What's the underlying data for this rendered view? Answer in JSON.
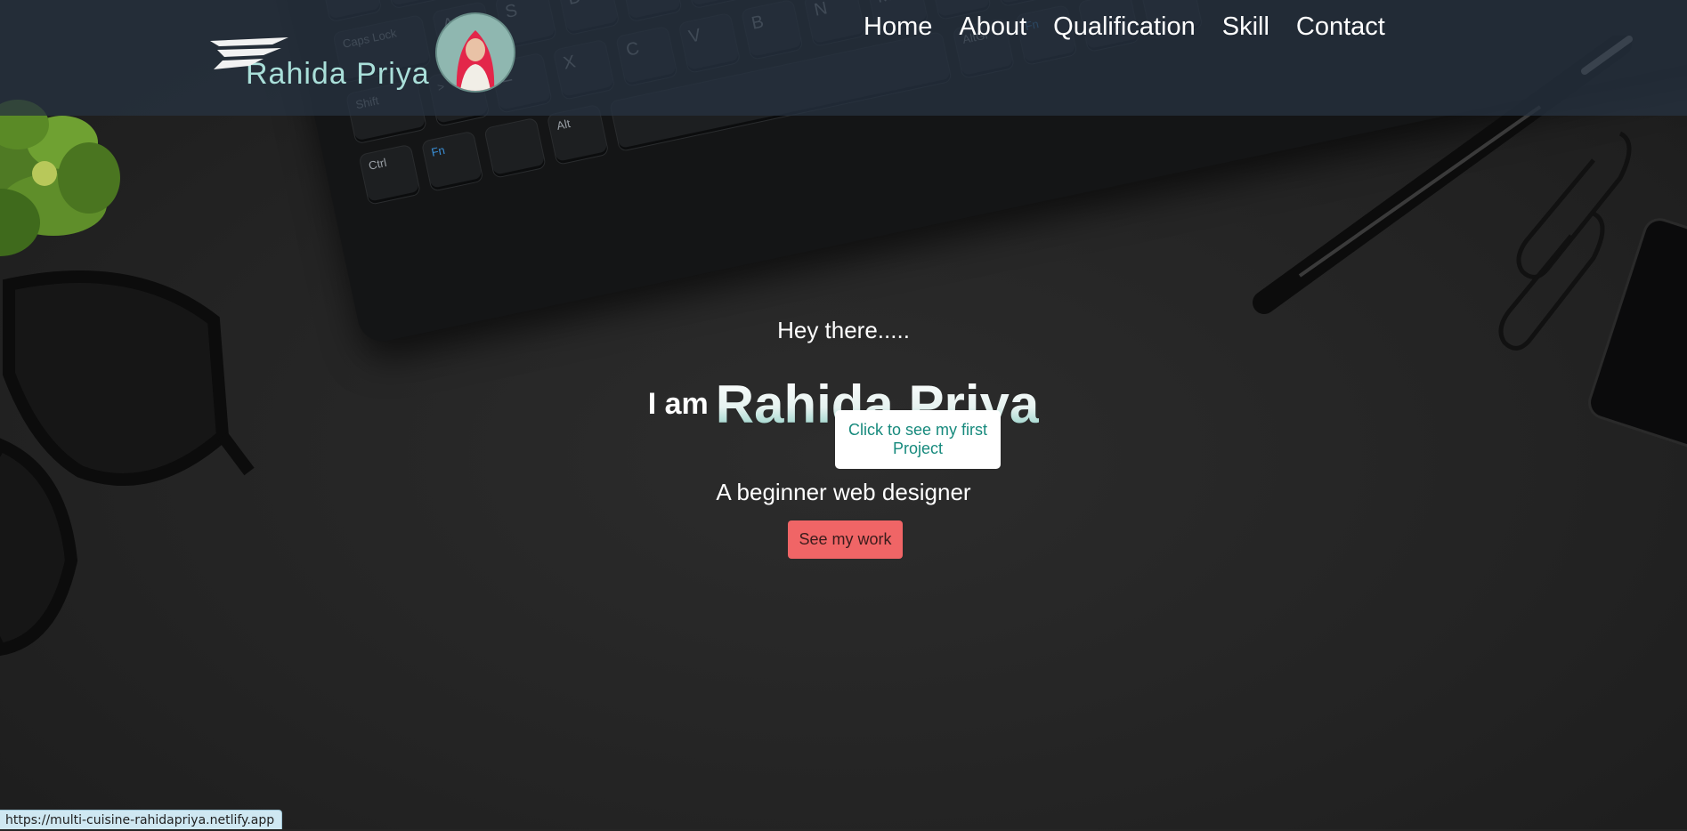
{
  "brand": {
    "logo_text": "Rahida Priya",
    "avatar_alt": "Rahida Priya profile photo"
  },
  "nav": {
    "items": [
      {
        "label": "Home"
      },
      {
        "label": "About"
      },
      {
        "label": "Qualification"
      },
      {
        "label": "Skill"
      },
      {
        "label": "Contact"
      }
    ]
  },
  "hero": {
    "greeting": "Hey there.....",
    "intro_prefix": "I am",
    "name": "Rahida Priya",
    "tagline": "A beginner web designer",
    "cta_label": "See my work",
    "tooltip": "Click to see my first Project"
  },
  "statusbar": {
    "url": "https://multi-cuisine-rahidapriya.netlify.app"
  },
  "colors": {
    "header_bg": "#263240",
    "logo_text": "#a9dfd9",
    "cta_bg": "#f06566",
    "tooltip_text": "#178a7d"
  }
}
